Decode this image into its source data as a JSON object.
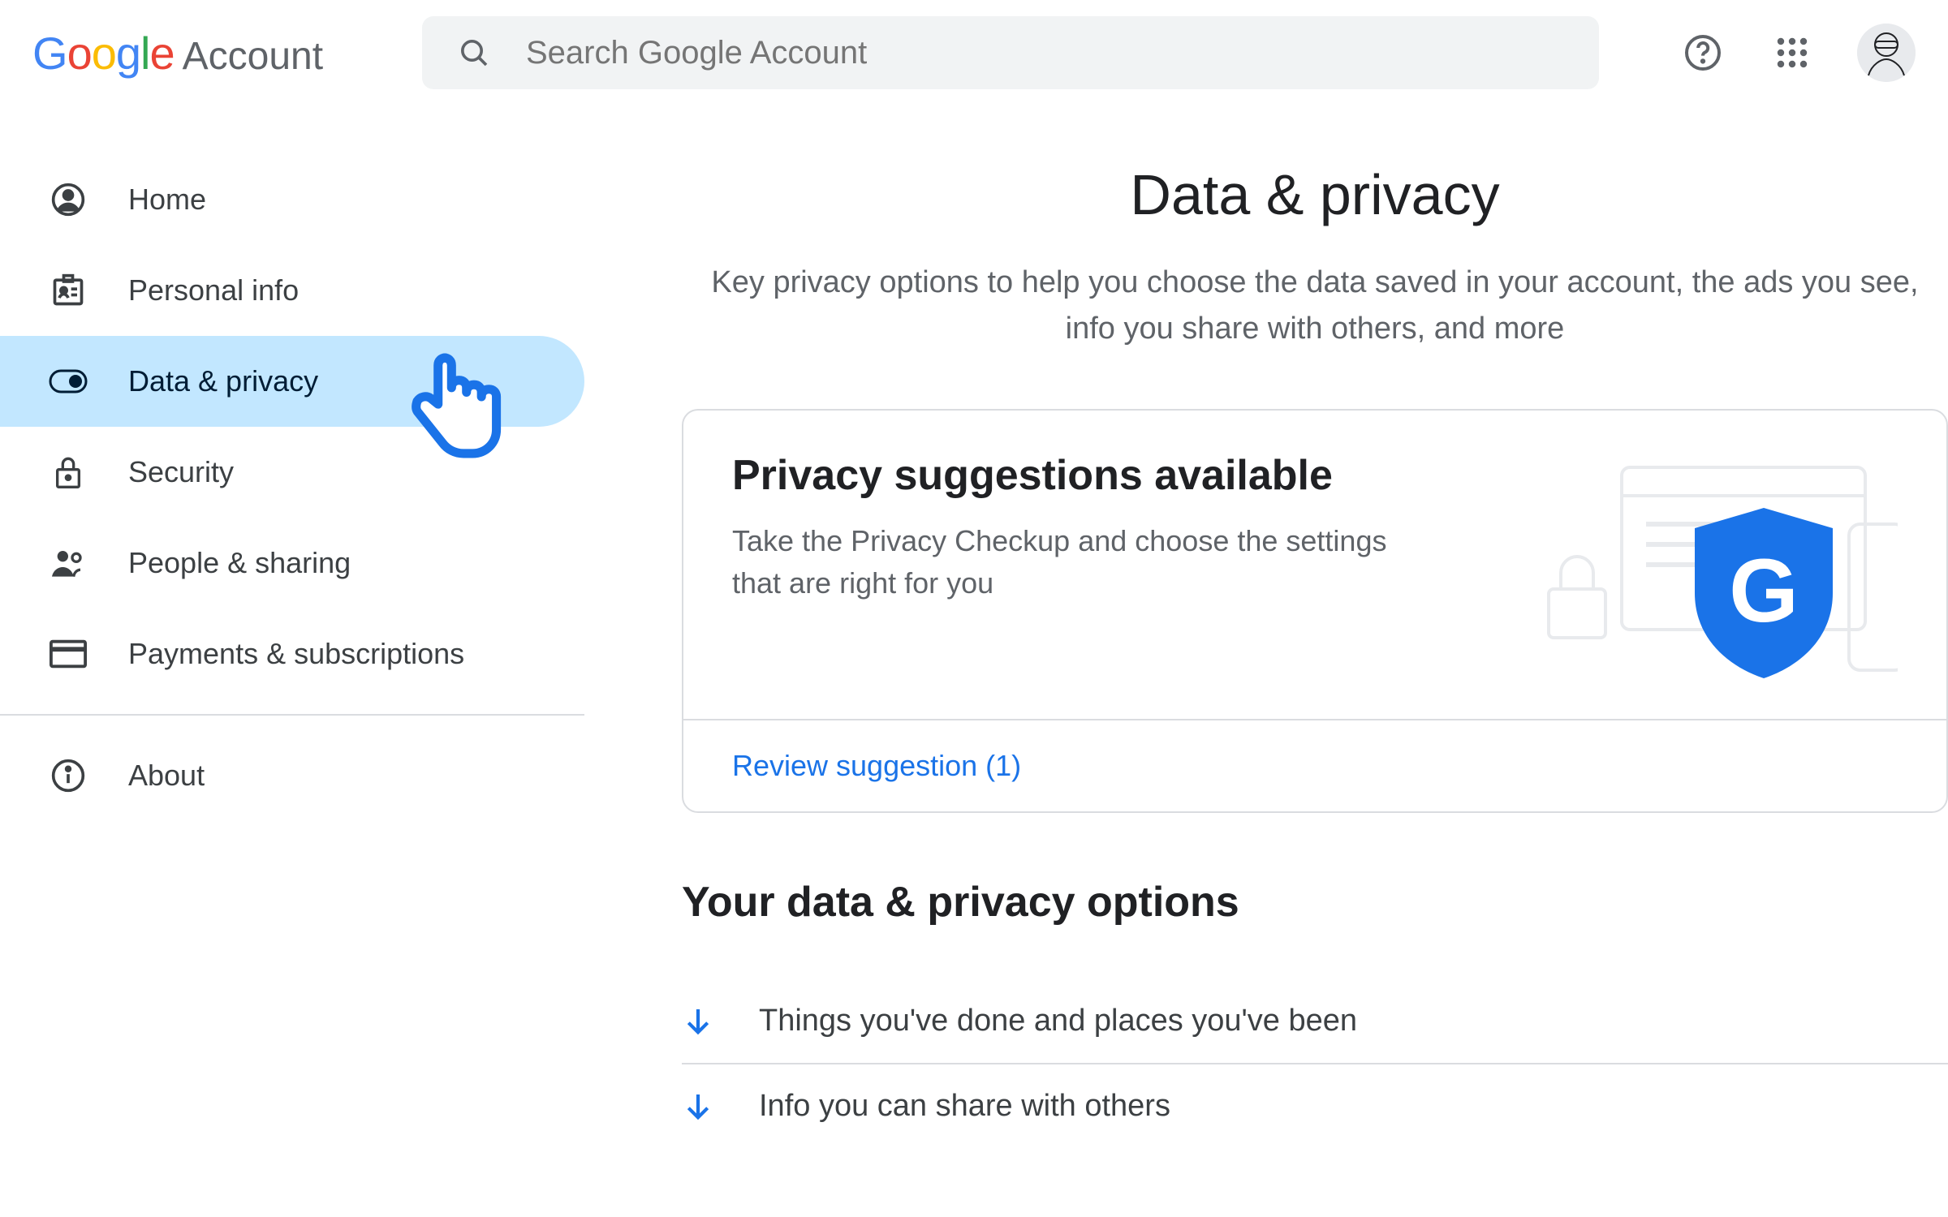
{
  "header": {
    "logo_product": "Account",
    "search_placeholder": "Search Google Account"
  },
  "sidebar": {
    "items": [
      {
        "label": "Home",
        "icon": "home"
      },
      {
        "label": "Personal info",
        "icon": "badge"
      },
      {
        "label": "Data & privacy",
        "icon": "toggle",
        "active": true
      },
      {
        "label": "Security",
        "icon": "lock"
      },
      {
        "label": "People & sharing",
        "icon": "people"
      },
      {
        "label": "Payments & subscriptions",
        "icon": "card"
      }
    ],
    "footer": {
      "label": "About",
      "icon": "info"
    }
  },
  "main": {
    "title": "Data & privacy",
    "subtitle": "Key privacy options to help you choose the data saved in your account, the ads you see, info you share with others, and more",
    "card": {
      "title": "Privacy suggestions available",
      "desc": "Take the Privacy Checkup and choose the settings that are right for you",
      "action": "Review suggestion (1)"
    },
    "options_title": "Your data & privacy options",
    "options": [
      "Things you've done and places you've been",
      "Info you can share with others"
    ]
  }
}
